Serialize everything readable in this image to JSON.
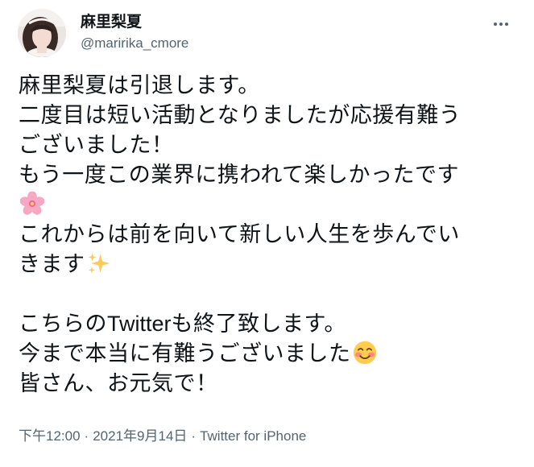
{
  "author": {
    "display_name": "麻里梨夏",
    "handle": "@maririka_cmore"
  },
  "tweet": {
    "line1": "麻里梨夏は引退します。",
    "line2": "二度目は短い活動となりましたが応援有難う",
    "line3": "ございました！",
    "line4": "もう一度この業界に携われて楽しかったです",
    "line5_emoji": "cherry-blossom-emoji",
    "line6": "これからは前を向いて新しい人生を歩んでい",
    "line7": "きます",
    "line7_emoji": "sparkles-emoji",
    "line8_a": "こちらの",
    "line8_b": "Twitter",
    "line8_c": "も終了致します。",
    "line9": "今まで本当に有難うございました",
    "line9_emoji": "smiling-face-emoji",
    "line10": "皆さん、お元気で！"
  },
  "meta": {
    "time": "下午12:00",
    "separator": "·",
    "date": "2021年9月14日",
    "source": "Twitter for iPhone"
  },
  "colors": {
    "text": "#0f1419",
    "secondary": "#536471"
  },
  "icons": {
    "more": "more-horizontal-icon"
  }
}
